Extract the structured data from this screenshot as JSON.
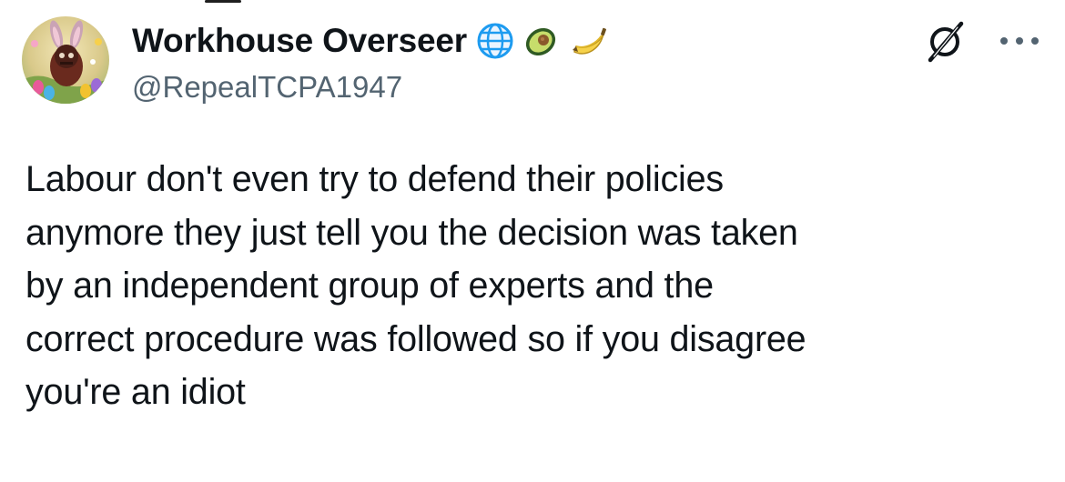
{
  "tweet": {
    "author": {
      "display_name": "Workhouse Overseer",
      "handle": "@RepealTCPA1947",
      "badges": [
        "globe-icon",
        "avocado-icon",
        "banana-icon"
      ]
    },
    "text_lines": [
      "Labour don't even try to defend their policies",
      "anymore they just tell you the decision was taken",
      "by an independent group of experts and the",
      "correct procedure was followed so if you disagree",
      "you're an idiot"
    ],
    "actions": {
      "grok_icon": "grok-icon",
      "more_icon": "more-icon"
    }
  },
  "colors": {
    "text": "#0f1419",
    "secondary": "#536471",
    "globe_blue": "#1d9bf0"
  }
}
